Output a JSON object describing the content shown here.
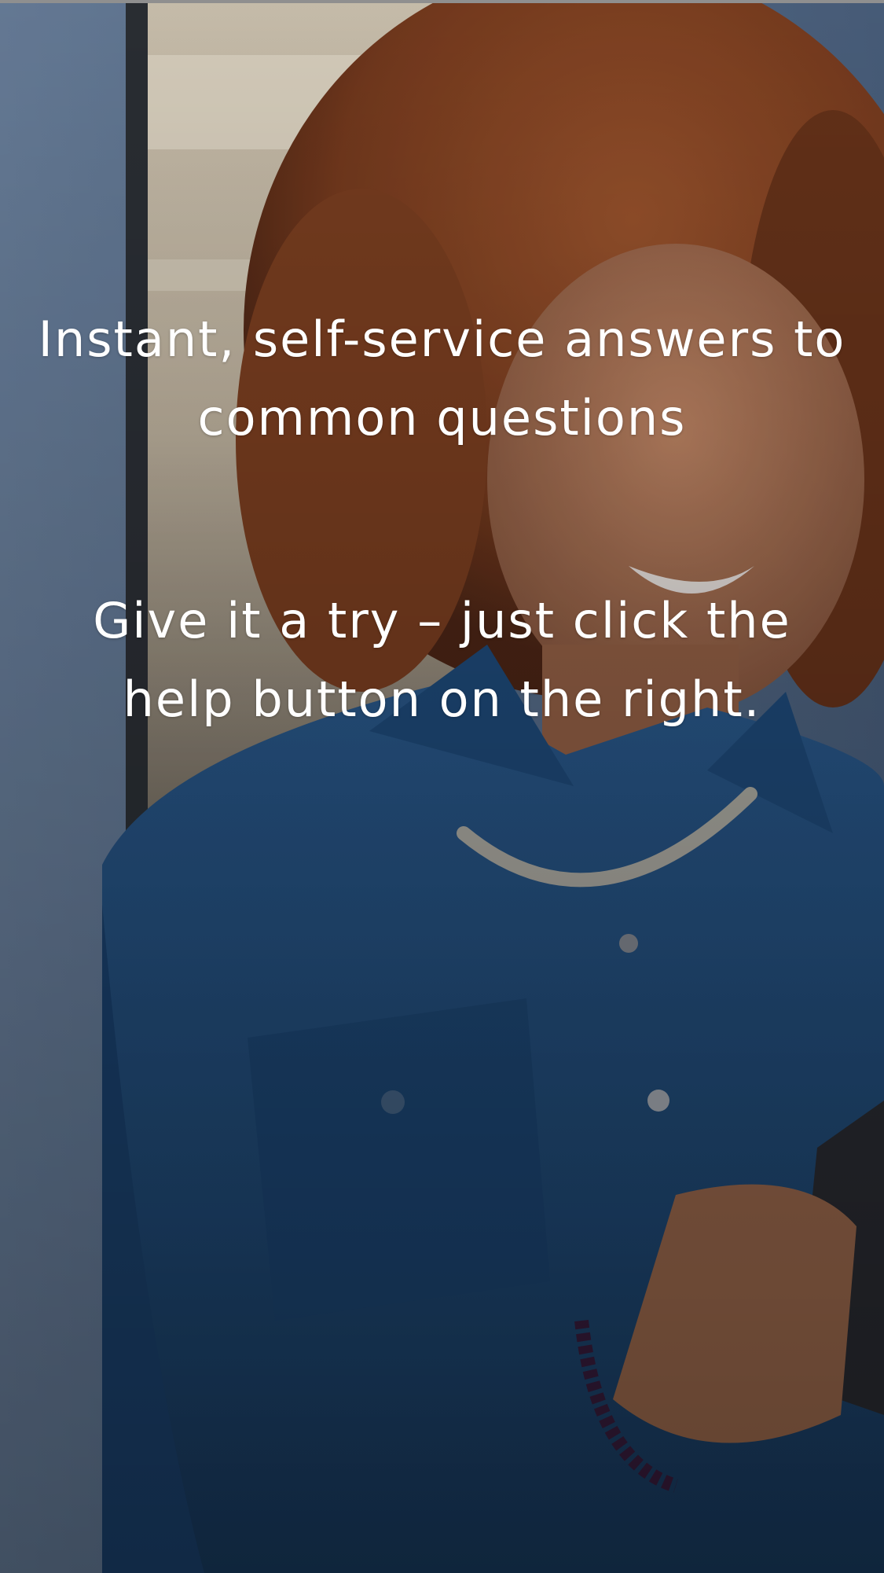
{
  "hero": {
    "headline": "Instant, self-service answers to common questions",
    "cta_text": "Give it a try – just click the help button on the right."
  }
}
